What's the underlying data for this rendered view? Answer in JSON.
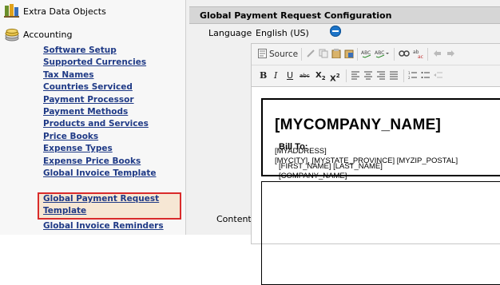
{
  "sidebar": {
    "groups": [
      {
        "label": "Extra Data Objects",
        "icon": "extra-data-objects-icon"
      },
      {
        "label": "Accounting",
        "icon": "accounting-coins-icon"
      }
    ],
    "links": [
      "Software Setup",
      "Supported Currencies",
      "Tax Names",
      "Countries Serviced",
      "Payment Processor",
      "Payment Methods",
      "Products and Services",
      "Price Books",
      "Expense Types",
      "Expense Price Books",
      "Global Invoice Template"
    ],
    "selected": [
      "Global Payment Request",
      "Template"
    ],
    "after": [
      "Global Invoice Reminders"
    ]
  },
  "main": {
    "title": "Global Payment Request Configuration",
    "language_label": "Language",
    "language_value": "English (US)",
    "content_label": "Content",
    "toolbar": {
      "source_label": "Source"
    },
    "document": {
      "company": "[MYCOMPANY_NAME]",
      "address1": "[MYADDRESS]",
      "address2": "[MYCITY], [MYSTATE_PROVINCE] [MYZIP_POSTAL]",
      "bill_to": "Bill To:",
      "name_line": "[FIRST_NAME] [LAST_NAME]",
      "company_line": "[COMPANY_NAME]"
    }
  }
}
